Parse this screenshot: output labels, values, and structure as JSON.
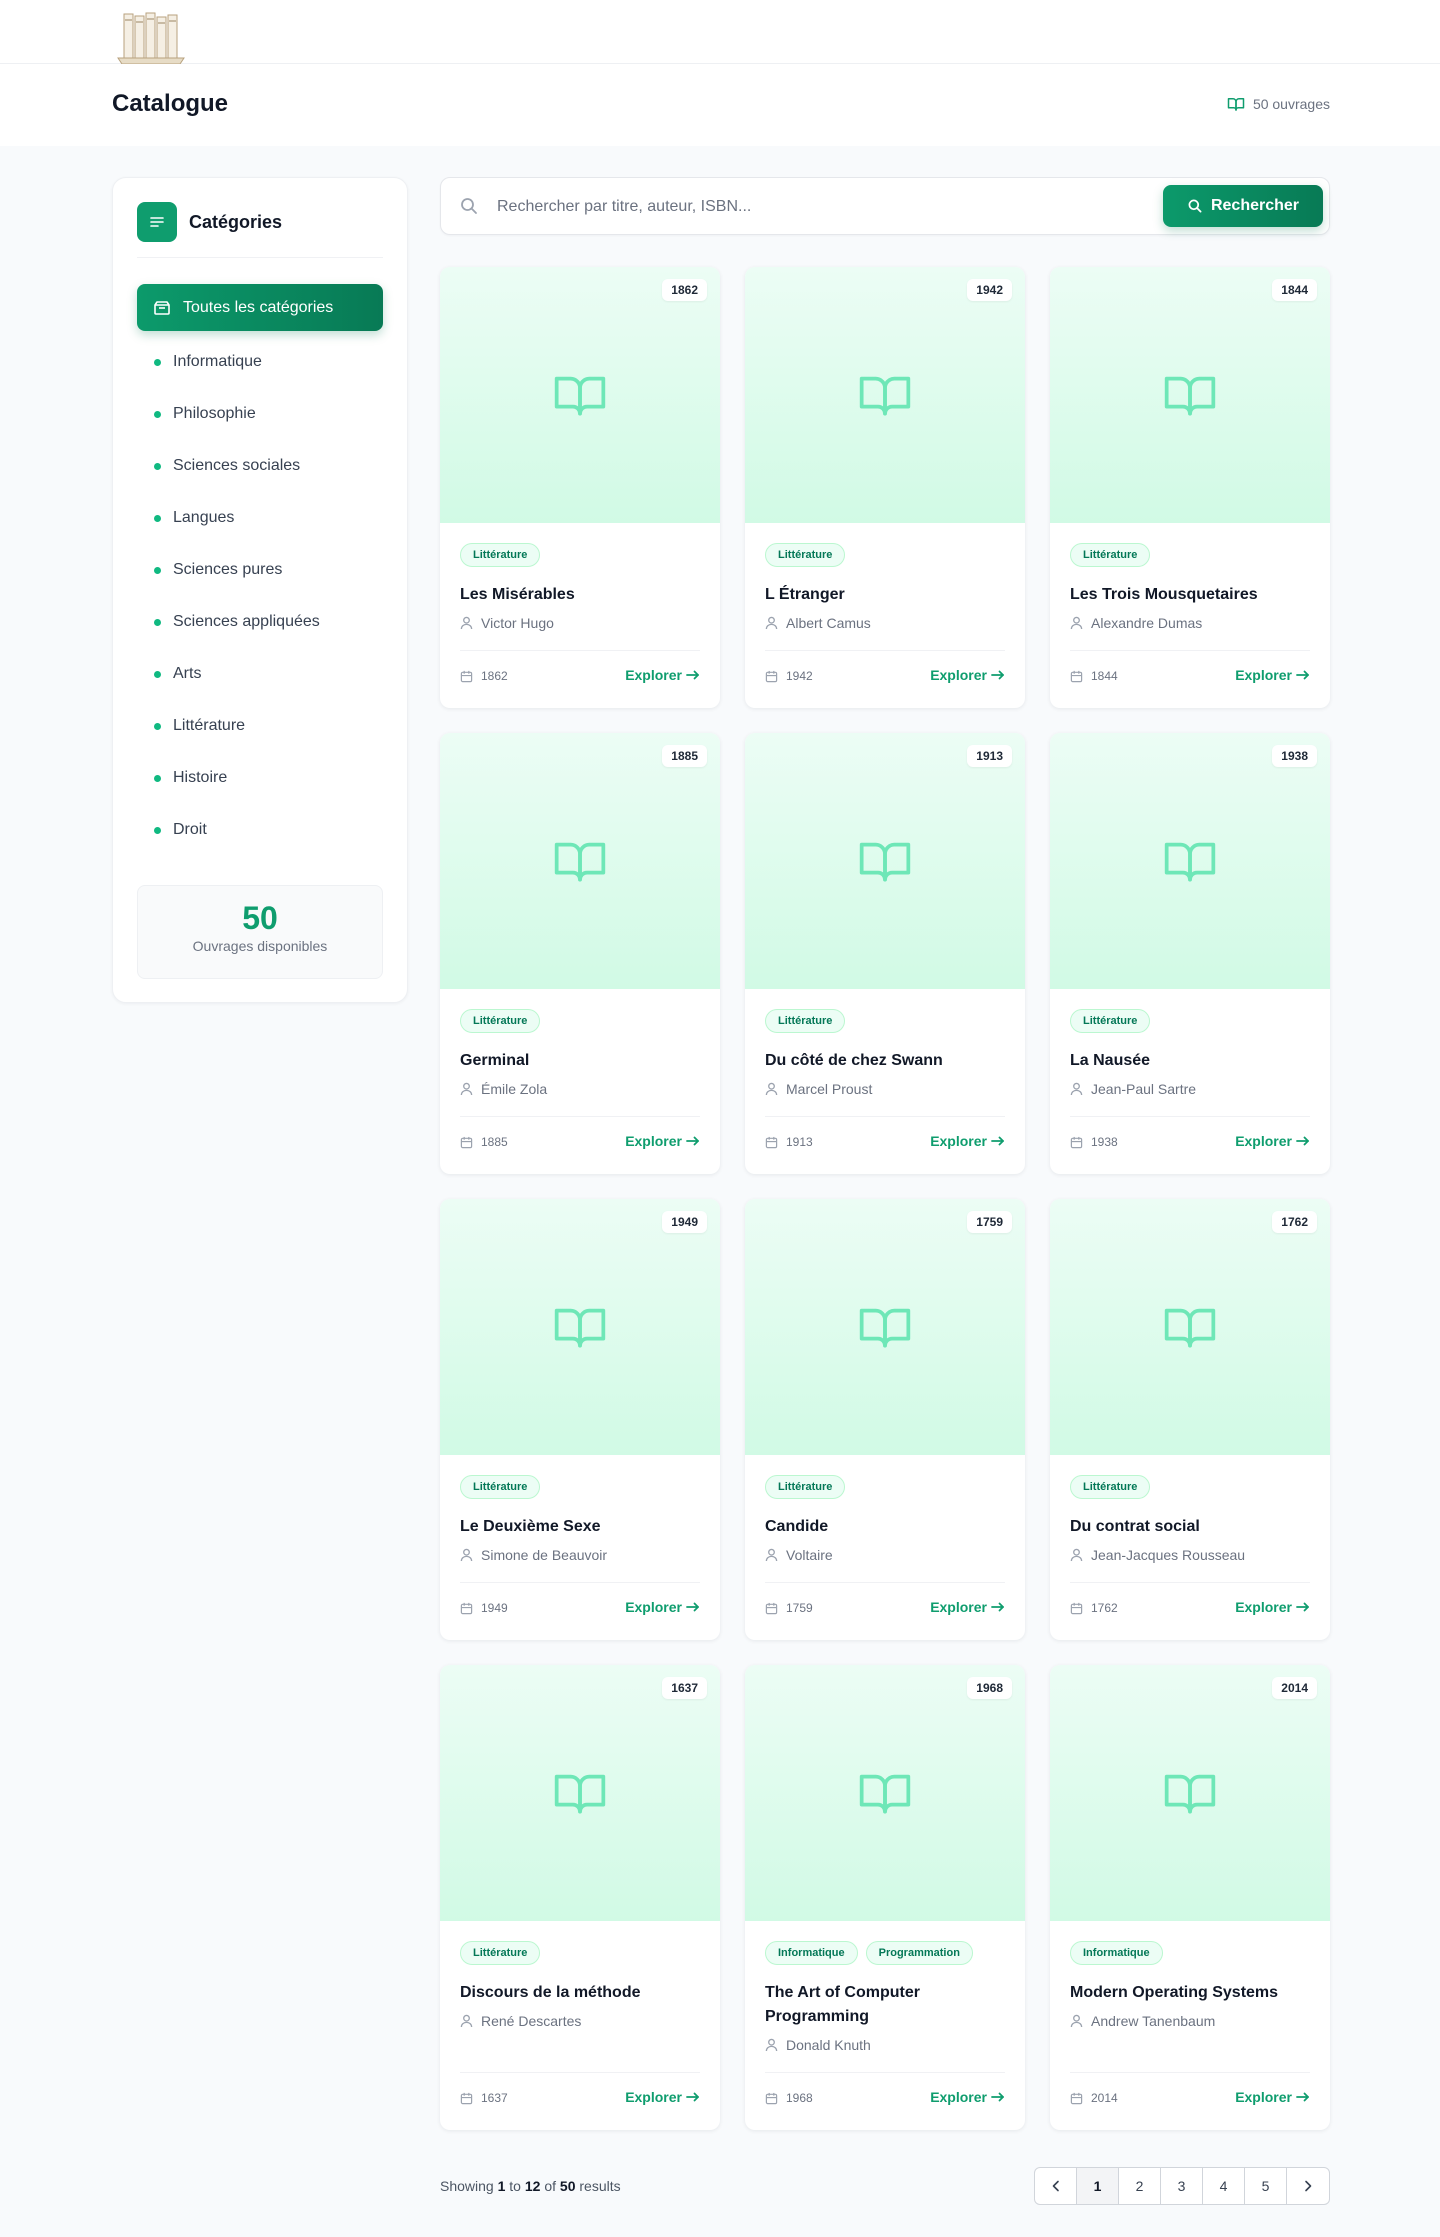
{
  "header": {
    "title": "Catalogue",
    "works_count": "50 ouvrages"
  },
  "sidebar": {
    "title": "Catégories",
    "all_label": "Toutes les catégories",
    "items": [
      {
        "label": "Informatique"
      },
      {
        "label": "Philosophie"
      },
      {
        "label": "Sciences sociales"
      },
      {
        "label": "Langues"
      },
      {
        "label": "Sciences pures"
      },
      {
        "label": "Sciences appliquées"
      },
      {
        "label": "Arts"
      },
      {
        "label": "Littérature"
      },
      {
        "label": "Histoire"
      },
      {
        "label": "Droit"
      }
    ],
    "stat_value": "50",
    "stat_label": "Ouvrages disponibles"
  },
  "search": {
    "placeholder": "Rechercher par titre, auteur, ISBN...",
    "value": "",
    "button_label": "Rechercher"
  },
  "explore_label": "Explorer",
  "books": [
    {
      "title": "Les Misérables",
      "author": "Victor Hugo",
      "year": "1862",
      "tags": [
        "Littérature"
      ]
    },
    {
      "title": "L Étranger",
      "author": "Albert Camus",
      "year": "1942",
      "tags": [
        "Littérature"
      ]
    },
    {
      "title": "Les Trois Mousquetaires",
      "author": "Alexandre Dumas",
      "year": "1844",
      "tags": [
        "Littérature"
      ]
    },
    {
      "title": "Germinal",
      "author": "Émile Zola",
      "year": "1885",
      "tags": [
        "Littérature"
      ]
    },
    {
      "title": "Du côté de chez Swann",
      "author": "Marcel Proust",
      "year": "1913",
      "tags": [
        "Littérature"
      ]
    },
    {
      "title": "La Nausée",
      "author": "Jean-Paul Sartre",
      "year": "1938",
      "tags": [
        "Littérature"
      ]
    },
    {
      "title": "Le Deuxième Sexe",
      "author": "Simone de Beauvoir",
      "year": "1949",
      "tags": [
        "Littérature"
      ]
    },
    {
      "title": "Candide",
      "author": "Voltaire",
      "year": "1759",
      "tags": [
        "Littérature"
      ]
    },
    {
      "title": "Du contrat social",
      "author": "Jean-Jacques Rousseau",
      "year": "1762",
      "tags": [
        "Littérature"
      ]
    },
    {
      "title": "Discours de la méthode",
      "author": "René Descartes",
      "year": "1637",
      "tags": [
        "Littérature"
      ]
    },
    {
      "title": "The Art of Computer Programming",
      "author": "Donald Knuth",
      "year": "1968",
      "tags": [
        "Informatique",
        "Programmation"
      ]
    },
    {
      "title": "Modern Operating Systems",
      "author": "Andrew Tanenbaum",
      "year": "2014",
      "tags": [
        "Informatique"
      ]
    }
  ],
  "pagination": {
    "showing": "Showing",
    "from": "1",
    "to_word": "to",
    "to": "12",
    "of_word": "of",
    "total": "50",
    "results_word": "results",
    "pages": [
      "1",
      "2",
      "3",
      "4",
      "5"
    ],
    "current": "1"
  },
  "colors": {
    "accent": "#0f9d6e",
    "cover_top": "#ecfdf5",
    "cover_bottom": "#d1fae5",
    "book_icon": "#6ee7b7"
  }
}
